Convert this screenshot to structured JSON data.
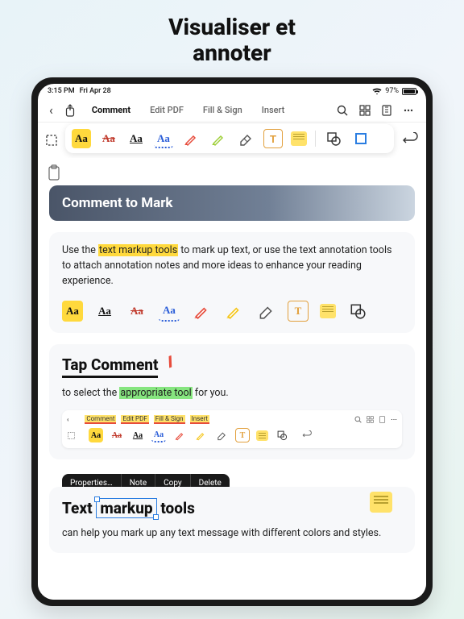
{
  "hero": {
    "line1": "Visualiser et",
    "line2": "annoter"
  },
  "statusbar": {
    "time": "3:15 PM",
    "date": "Fri Apr 28",
    "battery": "97%"
  },
  "tabs": {
    "comment": "Comment",
    "edit": "Edit PDF",
    "fill": "Fill & Sign",
    "insert": "Insert"
  },
  "banner": {
    "title": "Comment to Mark"
  },
  "intro": {
    "pre": "Use the ",
    "hl": "text markup tools",
    "post": " to mark up text, or use the text annotation tools to attach annotation notes and more ideas to enhance your reading experience."
  },
  "tap": {
    "title": "Tap Comment",
    "sub_pre": "to select the ",
    "sub_hl": "appropriate tool",
    "sub_post": " for you."
  },
  "mini_tabs": {
    "comment": "Comment",
    "edit": "Edit PDF",
    "fill": "Fill & Sign",
    "insert": "Insert"
  },
  "context": {
    "properties": "Properties…",
    "note": "Note",
    "copy": "Copy",
    "delete": "Delete"
  },
  "markup": {
    "pre": "Text ",
    "sel": "markup",
    "post": " tools",
    "sub": "can help you mark up any text message with different colors and styles."
  },
  "icon_text": {
    "aa": "Aa",
    "t": "T"
  }
}
